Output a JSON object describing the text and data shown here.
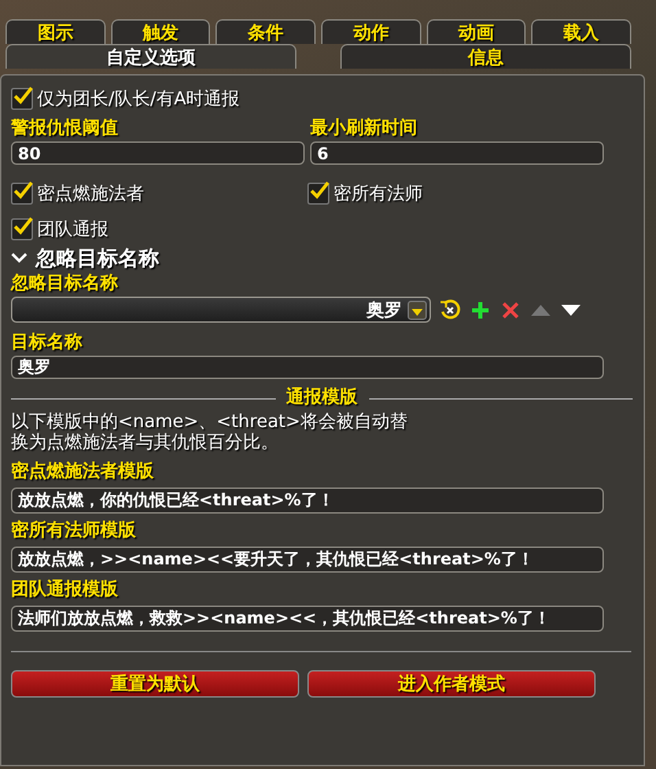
{
  "tabs_row_1": [
    {
      "label": "图示",
      "selected": false
    },
    {
      "label": "触发",
      "selected": false
    },
    {
      "label": "条件",
      "selected": false
    },
    {
      "label": "动作",
      "selected": false
    },
    {
      "label": "动画",
      "selected": false
    },
    {
      "label": "载入",
      "selected": false
    }
  ],
  "tabs_row_2": [
    {
      "label": "自定义选项",
      "selected": true
    },
    {
      "label": "信息",
      "selected": false
    }
  ],
  "announce_checkbox": {
    "label": "仅为团长/队长/有A时通报",
    "checked": true
  },
  "number_fields": [
    {
      "label": "警报仇恨阈值",
      "value": "80"
    },
    {
      "label": "最小刷新时间",
      "value": "6"
    }
  ],
  "whisper_checkboxes": [
    {
      "label": "密点燃施法者",
      "checked": true
    },
    {
      "label": "密所有法师",
      "checked": true
    }
  ],
  "raid_checkbox": {
    "label": "团队通报",
    "checked": true
  },
  "group": {
    "title": "忽略目标名称",
    "expanded": true
  },
  "ignore_list": {
    "label": "忽略目标名称",
    "value": "奥罗",
    "move_up": {
      "disabled": true
    },
    "move_down": {
      "disabled": false
    }
  },
  "target_name": {
    "label": "目标名称",
    "value": "奥罗"
  },
  "section_title": "通报模版",
  "description": "以下模版中的<name>、<threat>将会被自动替换为点燃施法者与其仇恨百分比。",
  "templates": [
    {
      "label": "密点燃施法者模版",
      "value": "放放点燃，你的仇恨已经<threat>%了！"
    },
    {
      "label": "密所有法师模版",
      "value": "放放点燃，>><name><<要升天了，其仇恨已经<threat>%了！"
    },
    {
      "label": "团队通报模版",
      "value": "法师们放放点燃，救救>><name><<，其仇恨已经<threat>%了！"
    }
  ],
  "buttons": [
    "重置为默认",
    "进入作者模式"
  ]
}
